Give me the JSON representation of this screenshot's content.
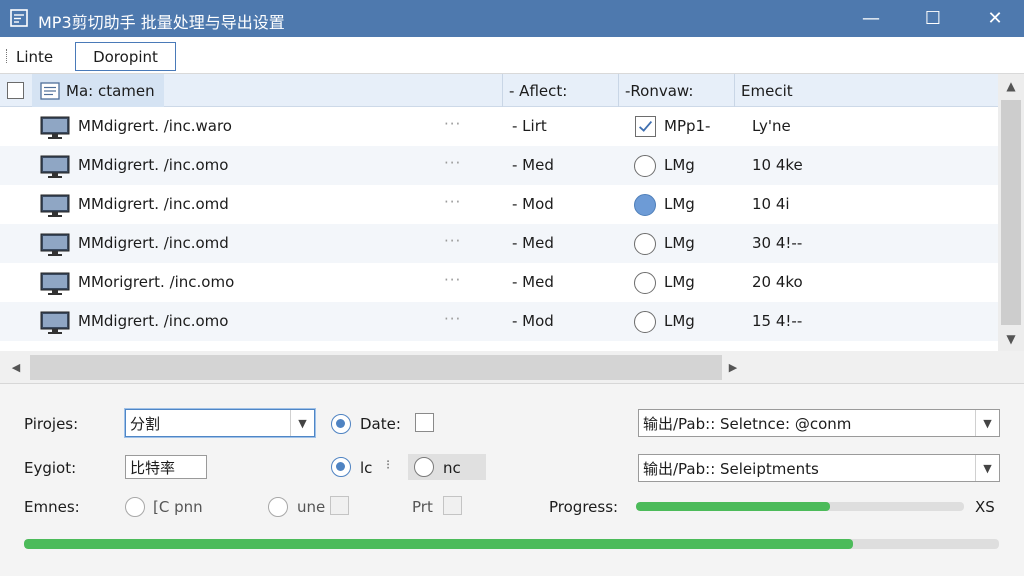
{
  "window": {
    "title": "MP3剪切助手 批量处理与导出设置",
    "min_glyph": "—",
    "max_glyph": "☐",
    "close_glyph": "✕"
  },
  "menu": {
    "tabs": [
      {
        "label": "Linte"
      },
      {
        "label": "Doropint"
      }
    ]
  },
  "list": {
    "columns": [
      {
        "label": "Ma: ctamen"
      },
      {
        "label": "- Aflect:"
      },
      {
        "label": "-Ronvaw:"
      },
      {
        "label": "Emecit"
      }
    ],
    "rows": [
      {
        "name": "MMdigrert. /inc.waro",
        "dots": "···",
        "affect": "- Lirt",
        "review_control": "checkbox",
        "review_checked": true,
        "review": "MPp1-",
        "emit": "Ly'ne"
      },
      {
        "name": "MMdigrert. /inc.omo",
        "dots": "···",
        "affect": "- Med",
        "review_control": "radio",
        "review_checked": false,
        "review": "LMg",
        "emit": "10 4ke"
      },
      {
        "name": "MMdigrert. /inc.omd",
        "dots": "···",
        "affect": "- Mod",
        "review_control": "radio",
        "review_checked": true,
        "review": "LMg",
        "emit": "10 4i"
      },
      {
        "name": "MMdigrert. /inc.omd",
        "dots": "···",
        "affect": "- Med",
        "review_control": "radio",
        "review_checked": false,
        "review": "LMg",
        "emit": "30 4!--"
      },
      {
        "name": "MMorigrert. /inc.omo",
        "dots": "···",
        "affect": "- Med",
        "review_control": "radio",
        "review_checked": false,
        "review": "LMg",
        "emit": "20 4ko"
      },
      {
        "name": "MMdigrert. /inc.omo",
        "dots": "···",
        "affect": "- Mod",
        "review_control": "radio",
        "review_checked": false,
        "review": "LMg",
        "emit": "15 4!--"
      }
    ]
  },
  "settings": {
    "presets_label": "Pirojes:",
    "presets_value": "分割",
    "date_label": "Date:",
    "output_path_1": "输出/Pab:: Seletnce: @conm",
    "bitrate_label": "Eygiot:",
    "bitrate_value": "比特率",
    "opt_a_label": "lc",
    "opt_b_label": "nc",
    "output_path_2": "输出/Pab:: Seleiptments",
    "emnes_label": "Emnes:",
    "emnes_opt1": "[C pnn",
    "emnes_opt2": "une",
    "prt_label": "Prt",
    "progress_label": "Progress:",
    "progress_suffix": "XS",
    "progress_fraction": 0.59,
    "overall_fraction": 0.85
  },
  "colors": {
    "titlebar": "#4e79ae",
    "accent": "#4f83c2",
    "progress": "#4cbb5a"
  }
}
